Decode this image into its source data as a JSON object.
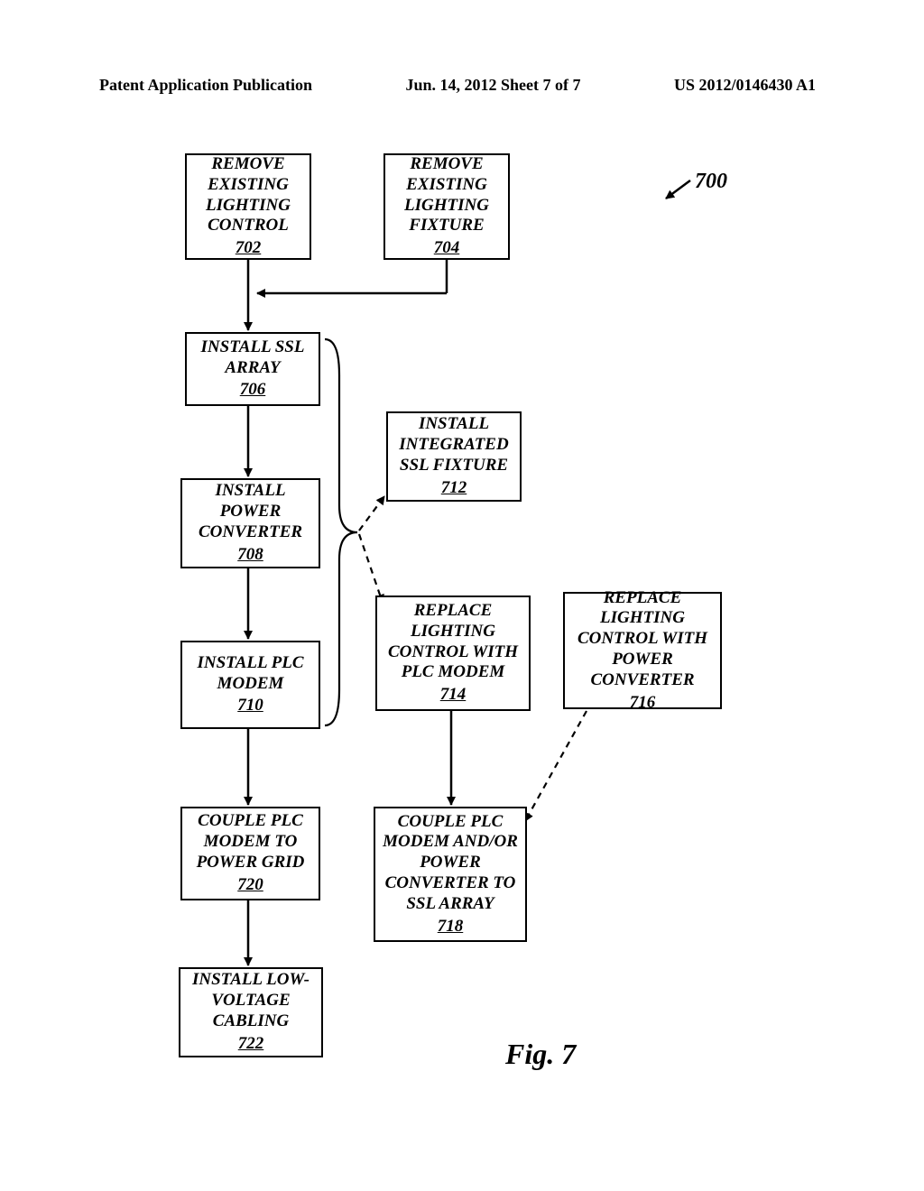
{
  "header": {
    "left": "Patent Application Publication",
    "center": "Jun. 14, 2012  Sheet 7 of 7",
    "right": "US 2012/0146430 A1"
  },
  "refnum": "700",
  "boxes": {
    "b702": {
      "text": "REMOVE EXISTING LIGHTING CONTROL",
      "ref": "702"
    },
    "b704": {
      "text": "REMOVE EXISTING LIGHTING FIXTURE",
      "ref": "704"
    },
    "b706": {
      "text": "INSTALL SSL ARRAY",
      "ref": "706"
    },
    "b708": {
      "text": "INSTALL POWER CONVERTER",
      "ref": "708"
    },
    "b710": {
      "text": "INSTALL PLC MODEM",
      "ref": "710"
    },
    "b712": {
      "text": "INSTALL INTEGRATED SSL FIXTURE",
      "ref": "712"
    },
    "b714": {
      "text": "REPLACE LIGHTING CONTROL WITH PLC MODEM",
      "ref": "714"
    },
    "b716": {
      "text": "REPLACE LIGHTING CONTROL WITH POWER CONVERTER",
      "ref": "716"
    },
    "b718": {
      "text": "COUPLE PLC MODEM AND/OR POWER CONVERTER TO SSL ARRAY",
      "ref": "718"
    },
    "b720": {
      "text": "COUPLE PLC MODEM TO POWER GRID",
      "ref": "720"
    },
    "b722": {
      "text": "INSTALL LOW-VOLTAGE CABLING",
      "ref": "722"
    }
  },
  "figcaption": "Fig. 7"
}
